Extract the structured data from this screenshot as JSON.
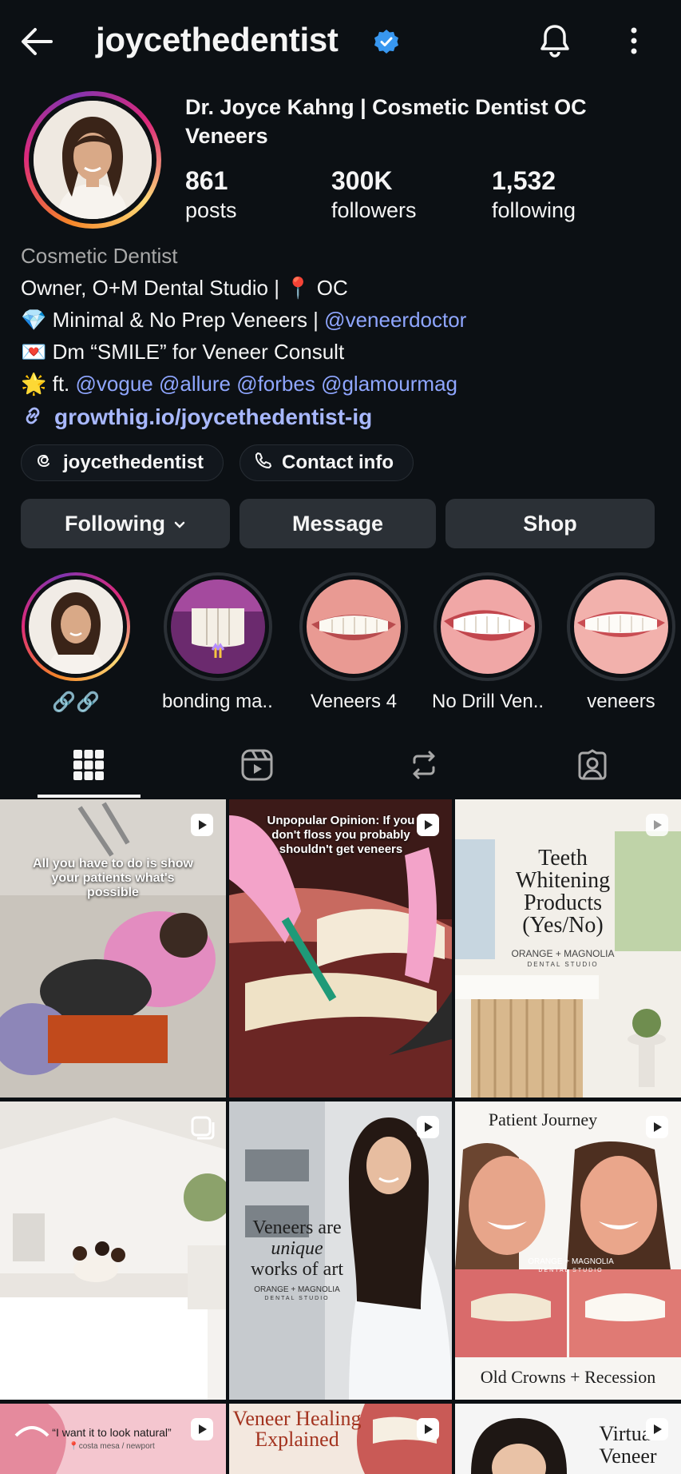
{
  "header": {
    "username": "joycethedentist"
  },
  "profile": {
    "display_name": "Dr. Joyce Kahng | Cosmetic Dentist OC Veneers",
    "stats": [
      {
        "value": "861",
        "label": "posts"
      },
      {
        "value": "300K",
        "label": "followers"
      },
      {
        "value": "1,532",
        "label": "following"
      }
    ],
    "category": "Cosmetic Dentist",
    "bio_line1": "Owner, O+M Dental Studio | 📍 OC",
    "bio_line2_text": "💎 Minimal & No Prep Veneers | ",
    "bio_line2_mention": "@veneerdoctor",
    "bio_line3": "💌 Dm “SMILE” for Veneer Consult",
    "bio_line4_prefix": "🌟 ft. ",
    "bio_mentions": [
      "@vogue",
      "@allure",
      "@forbes",
      "@glamourmag"
    ],
    "link": "growthig.io/joycethedentist-ig",
    "threads_label": "joycethedentist",
    "contact_label": "Contact info"
  },
  "actions": {
    "following": "Following",
    "message": "Message",
    "shop": "Shop"
  },
  "highlights": [
    {
      "label": "🔗🔗"
    },
    {
      "label": "bonding ma..."
    },
    {
      "label": "Veneers 4"
    },
    {
      "label": "No Drill Ven..."
    },
    {
      "label": "veneers"
    }
  ],
  "tabs": [
    "grid-tab",
    "reels-tab",
    "reposts-tab",
    "tagged-tab"
  ],
  "grid": {
    "p1_caption": "All you have to do is show your patients what's possible",
    "p2_caption": "Unpopular Opinion: If you don't floss you probably shouldn't get veneers",
    "p3_title": "Teeth Whitening Products (Yes/No)",
    "p3_brand": "ORANGE + MAGNOLIA",
    "p3_sub": "DENTAL STUDIO",
    "p5_title_1": "Veneers are",
    "p5_title_2": "unique",
    "p5_title_3": "works of art",
    "p5_brand": "ORANGE + MAGNOLIA",
    "p5_sub": "DENTAL STUDIO",
    "p6_top": "Patient Journey",
    "p6_brand": "ORANGE + MAGNOLIA",
    "p6_sub": "DENTAL STUDIO",
    "p6_bottom": "Old Crowns + Recession",
    "p7_caption": "“I want it to look natural”",
    "p7_sub": "📍costa mesa / newport",
    "p8_title": "Veneer Healing Explained",
    "p9_title": "Virtual Veneer"
  },
  "colors": {
    "background": "#0c1014",
    "button": "#2b3036",
    "link": "#8fa6ff",
    "verified": "#3897f0"
  }
}
